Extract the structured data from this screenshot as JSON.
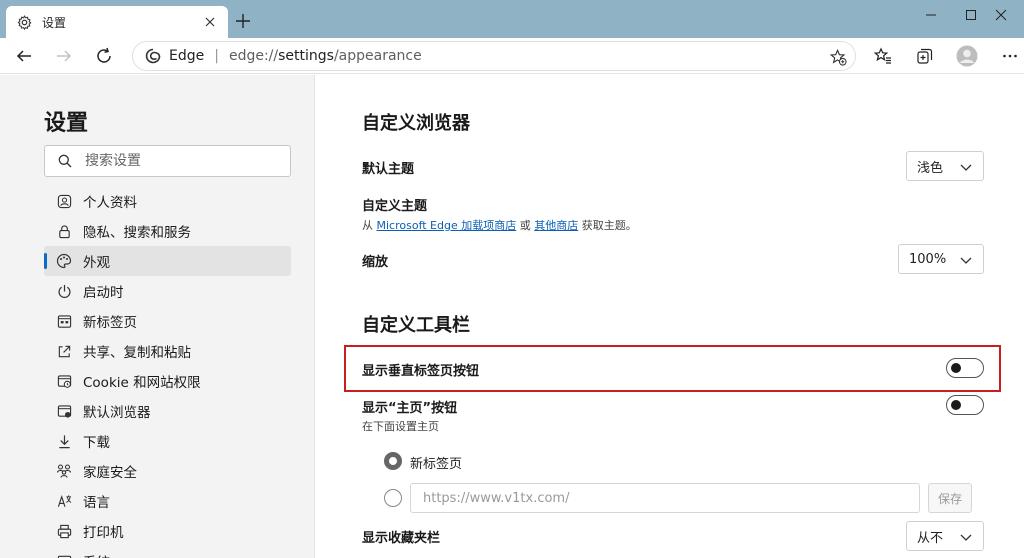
{
  "tab": {
    "title": "设置"
  },
  "address": {
    "site_name": "Edge",
    "url_prefix": "edge://",
    "url_host": "settings",
    "url_path": "/appearance"
  },
  "sidebar": {
    "title": "设置",
    "search_placeholder": "搜索设置",
    "items": [
      {
        "label": "个人资料",
        "icon": "profile-icon"
      },
      {
        "label": "隐私、搜索和服务",
        "icon": "lock-icon"
      },
      {
        "label": "外观",
        "icon": "palette-icon",
        "active": true
      },
      {
        "label": "启动时",
        "icon": "power-icon"
      },
      {
        "label": "新标签页",
        "icon": "newtab-icon"
      },
      {
        "label": "共享、复制和粘贴",
        "icon": "share-icon"
      },
      {
        "label": "Cookie 和网站权限",
        "icon": "site-permissions-icon"
      },
      {
        "label": "默认浏览器",
        "icon": "browser-icon"
      },
      {
        "label": "下载",
        "icon": "download-icon"
      },
      {
        "label": "家庭安全",
        "icon": "family-icon"
      },
      {
        "label": "语言",
        "icon": "language-icon"
      },
      {
        "label": "打印机",
        "icon": "printer-icon"
      },
      {
        "label": "系统",
        "icon": "system-icon"
      }
    ]
  },
  "main": {
    "section1_title": "自定义浏览器",
    "theme": {
      "label": "默认主题",
      "value": "浅色"
    },
    "custom_theme": {
      "label": "自定义主题",
      "sub_prefix": "从 ",
      "store_link": "Microsoft Edge 加载项商店",
      "sub_or": " 或 ",
      "other_link": "其他商店",
      "sub_suffix": " 获取主题。"
    },
    "zoom": {
      "label": "缩放",
      "value": "100%"
    },
    "section2_title": "自定义工具栏",
    "vertical_tabs": {
      "label": "显示垂直标签页按钮",
      "enabled": false
    },
    "home_button": {
      "label": "显示“主页”按钮",
      "sub": "在下面设置主页",
      "enabled": false
    },
    "home_options": {
      "newtab_label": "新标签页",
      "url_placeholder": "https://www.v1tx.com/",
      "save_label": "保存"
    },
    "favorites_bar": {
      "label": "显示收藏夹栏",
      "value": "从不"
    }
  },
  "colors": {
    "accent": "#0a6cc7",
    "highlight_border": "#c81e1e",
    "tabstrip": "#8fb2c4"
  }
}
